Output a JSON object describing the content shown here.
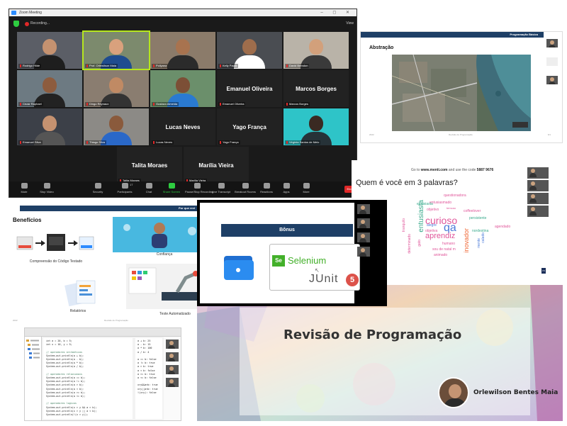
{
  "zoom": {
    "window_title": "Zoom Meeting",
    "recording_label": "Recording...",
    "view_label": "View",
    "window_controls": "–  ◻  ✕",
    "tiles": [
      {
        "label": "Rodrigo Hilde",
        "type": "video",
        "active": false
      },
      {
        "label": "Prof. Orlewilson Maia",
        "type": "video",
        "active": true
      },
      {
        "label": "Pollyana",
        "type": "video",
        "active": false
      },
      {
        "label": "Kelly Paula",
        "type": "video",
        "active": false
      },
      {
        "label": "David Brendon",
        "type": "video",
        "active": false
      },
      {
        "label": "Cezar Raphael",
        "type": "video",
        "active": false
      },
      {
        "label": "Dingo Reynaux",
        "type": "video",
        "active": false
      },
      {
        "label": "Gustavo Almeida",
        "type": "video",
        "active": false
      },
      {
        "label": "Emanuel Oliveira",
        "type": "name",
        "active": false
      },
      {
        "label": "Marcos Borges",
        "type": "name",
        "active": false
      },
      {
        "label": "Emanuel Silva",
        "type": "video",
        "active": false
      },
      {
        "label": "Thiago Silva",
        "type": "video",
        "active": false
      },
      {
        "label": "Lucas Neves",
        "type": "name",
        "active": false
      },
      {
        "label": "Yago França",
        "type": "name",
        "active": false
      },
      {
        "label": "Virgínia Santos de Melo",
        "type": "video",
        "active": false
      },
      {
        "label": "Talita Moraes",
        "type": "name",
        "active": false
      },
      {
        "label": "Marília Vieira",
        "type": "name",
        "active": false
      }
    ],
    "toolbar": [
      {
        "label": "Mute",
        "icon": "mic-icon"
      },
      {
        "label": "Stop Video",
        "icon": "video-icon"
      },
      {
        "label": "Security",
        "icon": "shield-icon"
      },
      {
        "label": "Participants",
        "icon": "participants-icon"
      },
      {
        "label": "Chat",
        "icon": "chat-icon"
      },
      {
        "label": "Share Screen",
        "icon": "share-screen-icon"
      },
      {
        "label": "Pause/Stop Recording",
        "icon": "pause-icon"
      },
      {
        "label": "Live Transcript",
        "icon": "cc-icon"
      },
      {
        "label": "Breakout Rooms",
        "icon": "breakout-icon"
      },
      {
        "label": "Reactions",
        "icon": "smile-icon"
      },
      {
        "label": "Apps",
        "icon": "apps-icon"
      },
      {
        "label": "More",
        "icon": "more-icon"
      }
    ],
    "participants_count": "17",
    "end_label": "End"
  },
  "abstracao": {
    "header": "Programação Básica",
    "title": "Abstração",
    "footer_left": "2022",
    "footer_center": "Revisão de Programação",
    "footer_right": "6/1"
  },
  "menti": {
    "code_prefix": "Go to",
    "code_url": "www.menti.com",
    "code_mid": "and use the code",
    "code": "5887 9676",
    "question": "Quem é você em 3 palavras?",
    "words": [
      {
        "text": "questionadora",
        "color": "#e0569a",
        "size": 5
      },
      {
        "text": "entusiasmado",
        "color": "#e0569a",
        "size": 5
      },
      {
        "text": "entusiasta",
        "color": "#3aaa8c",
        "size": 5
      },
      {
        "text": "temcao",
        "color": "#e0569a",
        "size": 4
      },
      {
        "text": "objetivo",
        "color": "#e0569a",
        "size": 5
      },
      {
        "text": "coffeelover",
        "color": "#e0569a",
        "size": 5
      },
      {
        "text": "curioso",
        "color": "#e0569a",
        "size": 14
      },
      {
        "text": "qa",
        "color": "#4a7ad9",
        "size": 16
      },
      {
        "text": "persistente",
        "color": "#3aaa8c",
        "size": 5
      },
      {
        "text": "alegre",
        "color": "#4a7ad9",
        "size": 5
      },
      {
        "text": "objetiva",
        "color": "#e0569a",
        "size": 5
      },
      {
        "text": "aprendiz",
        "color": "#e0569a",
        "size": 11
      },
      {
        "text": "nordestina",
        "color": "#3aaa8c",
        "size": 5
      },
      {
        "text": "agendado",
        "color": "#e0569a",
        "size": 5
      },
      {
        "text": "humano",
        "color": "#e0569a",
        "size": 5
      },
      {
        "text": "sou de natal m",
        "color": "#e0569a",
        "size": 5
      },
      {
        "text": "animado",
        "color": "#e0569a",
        "size": 5
      },
      {
        "text": "entusiasta",
        "color": "#3aaa8c",
        "size": 10,
        "vertical": true
      },
      {
        "text": "tranquilo",
        "color": "#e0569a",
        "size": 5,
        "vertical": true
      },
      {
        "text": "determinado",
        "color": "#e0569a",
        "size": 5,
        "vertical": true
      },
      {
        "text": "gato",
        "color": "#e0569a",
        "size": 5,
        "vertical": true
      },
      {
        "text": "inovador",
        "color": "#f06b3a",
        "size": 9,
        "vertical": true
      },
      {
        "text": "calado",
        "color": "#4a7ad9",
        "size": 5,
        "vertical": true
      },
      {
        "text": "mente",
        "color": "#4a7ad9",
        "size": 5,
        "vertical": true
      }
    ]
  },
  "beneficios": {
    "header": "Por que revi",
    "title": "Benefícios",
    "captions": [
      "Compreensão do Código Testado",
      "Confiança",
      "Relatórios",
      "Teste Automatizado"
    ],
    "footer_left": "2022",
    "footer_center": "Revisão de Programação",
    "footer_right": "6"
  },
  "bonus": {
    "title": "Bônus",
    "selenium_badge": "Se",
    "selenium": "Selenium",
    "junit": "JUnit",
    "junit_version": "5"
  },
  "ide": {
    "code_lines": [
      {
        "t": "int a = 20, b = 5;",
        "c": ""
      },
      {
        "t": "int x = 10, y = 5;",
        "c": ""
      },
      {
        "t": "",
        "c": ""
      },
      {
        "t": "// operadores aritmeticos",
        "c": "cm"
      },
      {
        "t": "System.out.println(a + b);",
        "c": ""
      },
      {
        "t": "System.out.println(a - b);",
        "c": ""
      },
      {
        "t": "System.out.println(a * b);",
        "c": ""
      },
      {
        "t": "System.out.println(a / b);",
        "c": ""
      },
      {
        "t": "",
        "c": ""
      },
      {
        "t": "// operadores relacionais",
        "c": "cm"
      },
      {
        "t": "System.out.println(a == b);",
        "c": ""
      },
      {
        "t": "System.out.println(a != b);",
        "c": ""
      },
      {
        "t": "System.out.println(a > b);",
        "c": ""
      },
      {
        "t": "System.out.println(a < b);",
        "c": ""
      },
      {
        "t": "System.out.println(a >= b);",
        "c": ""
      },
      {
        "t": "System.out.println(a <= b);",
        "c": ""
      },
      {
        "t": "",
        "c": ""
      },
      {
        "t": "// operadores logicos",
        "c": "cm"
      },
      {
        "t": "System.out.println(x > y && a > b);",
        "c": ""
      },
      {
        "t": "System.out.println(x > y || a < b);",
        "c": ""
      },
      {
        "t": "System.out.println(!(x > y));",
        "c": ""
      }
    ],
    "console_lines": [
      "a + b: 25",
      "a - b: 15",
      "a * b: 100",
      "a / b: 4",
      "",
      "a == b: false",
      "a != b: true",
      "a > b: true",
      "a < b: false",
      "a >= b: true",
      "a <= b: false",
      "",
      "x>y&&a>b: true",
      "x>y||a<b: true",
      "!(x>y): false"
    ]
  },
  "revisao": {
    "title": "Revisão de Programação",
    "author": "Orlewilson Bentes Maia"
  }
}
